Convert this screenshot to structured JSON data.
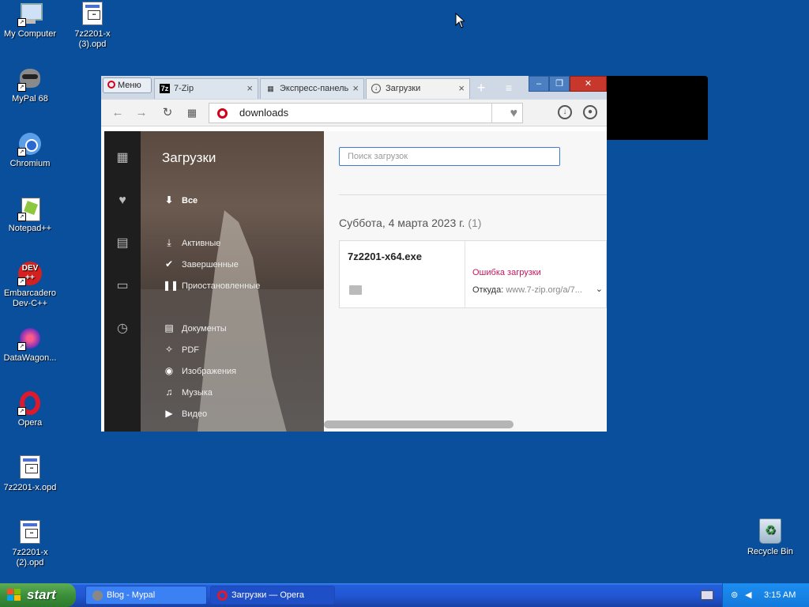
{
  "desktop": {
    "icons": [
      {
        "label": "My Computer"
      },
      {
        "label": "7z2201-x (3).opd"
      },
      {
        "label": "MyPal 68"
      },
      {
        "label": "Chromium"
      },
      {
        "label": "Notepad++"
      },
      {
        "label": "Embarcadero Dev-C++"
      },
      {
        "label": "DataWagon..."
      },
      {
        "label": "Opera"
      },
      {
        "label": "7z2201-x.opd"
      },
      {
        "label": "7z2201-x (2).opd"
      }
    ],
    "recycle_bin": "Recycle Bin"
  },
  "browser": {
    "menu_label": "Меню",
    "tabs": [
      {
        "label": "7-Zip",
        "icon": "7z"
      },
      {
        "label": "Экспресс-панель",
        "icon": "grid-icon"
      },
      {
        "label": "Загрузки",
        "icon": "download-icon"
      }
    ],
    "new_tab": "+",
    "address": "downloads",
    "window_buttons": {
      "minimize": "‒",
      "restore": "❐",
      "close": "✕"
    }
  },
  "downloads_page": {
    "title": "Загрузки",
    "nav": {
      "all": "Все",
      "active": "Активные",
      "completed": "Завершенные",
      "paused": "Приостановленные",
      "documents": "Документы",
      "pdf": "PDF",
      "images": "Изображения",
      "music": "Музыка",
      "video": "Видео"
    },
    "search_placeholder": "Поиск загрузок",
    "date_group": "Суббота, 4 марта 2023 г.",
    "date_count": "(1)",
    "item": {
      "filename": "7z2201-x64.exe",
      "status": "Ошибка загрузки",
      "from_label": "Откуда:",
      "from_url": "www.7-zip.org/a/7..."
    }
  },
  "taskbar": {
    "start": "start",
    "items": [
      {
        "label": "Blog - Mypal"
      },
      {
        "label": "Загрузки — Opera"
      }
    ],
    "clock": "3:15 AM"
  }
}
